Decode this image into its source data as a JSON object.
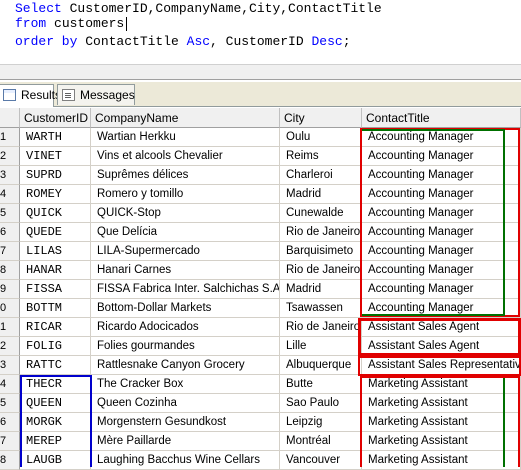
{
  "editor": {
    "line1": {
      "kw1": "Select",
      "rest": " CustomerID,CompanyName,City,ContactTitle"
    },
    "line2": {
      "kw1": "from",
      "rest": " customers"
    },
    "line3": {
      "kw1": "order by",
      "mid": " ContactTitle ",
      "kw2": "Asc",
      "mid2": ", CustomerID ",
      "kw3": "Desc",
      "end": ";"
    }
  },
  "tabs": {
    "results": "Results",
    "messages": "Messages"
  },
  "grid": {
    "columns": [
      "CustomerID",
      "CompanyName",
      "City",
      "ContactTitle"
    ],
    "rows": [
      {
        "num": "1",
        "id": "WARTH",
        "company": "Wartian Herkku",
        "city": "Oulu",
        "title": "Accounting Manager"
      },
      {
        "num": "2",
        "id": "VINET",
        "company": "Vins et alcools Chevalier",
        "city": "Reims",
        "title": "Accounting Manager"
      },
      {
        "num": "3",
        "id": "SUPRD",
        "company": "Suprêmes délices",
        "city": "Charleroi",
        "title": "Accounting Manager"
      },
      {
        "num": "4",
        "id": "ROMEY",
        "company": "Romero y tomillo",
        "city": "Madrid",
        "title": "Accounting Manager"
      },
      {
        "num": "5",
        "id": "QUICK",
        "company": "QUICK-Stop",
        "city": "Cunewalde",
        "title": "Accounting Manager"
      },
      {
        "num": "6",
        "id": "QUEDE",
        "company": "Que Delícia",
        "city": "Rio de Janeiro",
        "title": "Accounting Manager"
      },
      {
        "num": "7",
        "id": "LILAS",
        "company": "LILA-Supermercado",
        "city": "Barquisimeto",
        "title": "Accounting Manager"
      },
      {
        "num": "8",
        "id": "HANAR",
        "company": "Hanari Carnes",
        "city": "Rio de Janeiro",
        "title": "Accounting Manager"
      },
      {
        "num": "9",
        "id": "FISSA",
        "company": "FISSA Fabrica Inter. Salchichas S.A.",
        "city": "Madrid",
        "title": "Accounting Manager"
      },
      {
        "num": "0",
        "id": "BOTTM",
        "company": "Bottom-Dollar Markets",
        "city": "Tsawassen",
        "title": "Accounting Manager"
      },
      {
        "num": "1",
        "id": "RICAR",
        "company": "Ricardo Adocicados",
        "city": "Rio de Janeiro",
        "title": "Assistant Sales Agent"
      },
      {
        "num": "2",
        "id": "FOLIG",
        "company": "Folies gourmandes",
        "city": "Lille",
        "title": "Assistant Sales Agent"
      },
      {
        "num": "3",
        "id": "RATTC",
        "company": "Rattlesnake Canyon Grocery",
        "city": "Albuquerque",
        "title": "Assistant Sales Representative"
      },
      {
        "num": "4",
        "id": "THECR",
        "company": "The Cracker Box",
        "city": "Butte",
        "title": "Marketing Assistant"
      },
      {
        "num": "5",
        "id": "QUEEN",
        "company": "Queen Cozinha",
        "city": "Sao Paulo",
        "title": "Marketing Assistant"
      },
      {
        "num": "6",
        "id": "MORGK",
        "company": "Morgenstern Gesundkost",
        "city": "Leipzig",
        "title": "Marketing Assistant"
      },
      {
        "num": "7",
        "id": "MEREP",
        "company": "Mère Paillarde",
        "city": "Montréal",
        "title": "Marketing Assistant"
      },
      {
        "num": "8",
        "id": "LAUGB",
        "company": "Laughing Bacchus Wine Cellars",
        "city": "Vancouver",
        "title": "Marketing Assistant"
      }
    ]
  },
  "colors": {
    "keyword": "#0000ff",
    "annotation_red": "#e00000",
    "annotation_green": "#007000",
    "annotation_blue": "#0000cc"
  }
}
